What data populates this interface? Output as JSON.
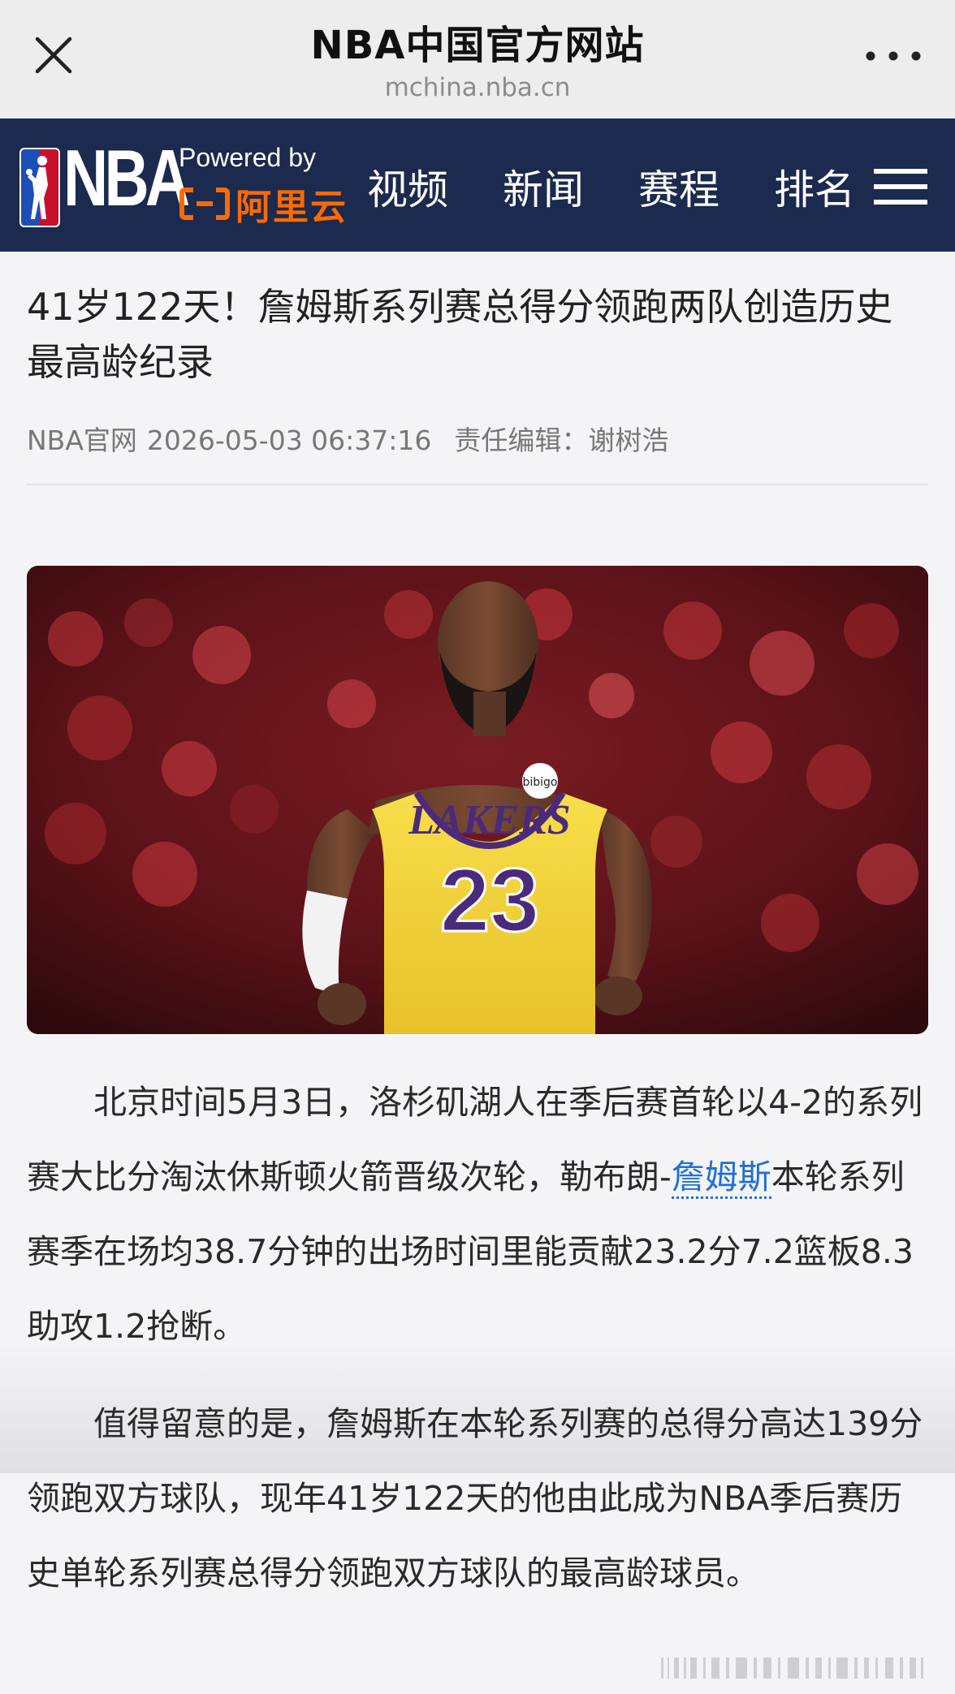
{
  "topbar": {
    "title": "NBA中国官方网站",
    "url": "mchina.nba.cn"
  },
  "navbar": {
    "logo": "NBA",
    "powered_by": "Powered by",
    "sponsor": "阿里云",
    "tabs": [
      "视频",
      "新闻",
      "赛程",
      "排名"
    ]
  },
  "article": {
    "title": "41岁122天！詹姆斯系列赛总得分领跑两队创造历史最高龄纪录",
    "source": "NBA官网",
    "datetime": "2026-05-03 06:37:16",
    "editor": "责任编辑：谢树浩",
    "image": {
      "jersey_team": "LAKERS",
      "jersey_number": "23",
      "patch": "bibigo"
    },
    "paragraph1": {
      "before_link": "北京时间5月3日，洛杉矶湖人在季后赛首轮以4-2的系列赛大比分淘汰休斯顿火箭晋级次轮，勒布朗-",
      "link": "詹姆斯",
      "after_link": "本轮系列赛季在场均38.7分钟的出场时间里能贡献23.2分7.2篮板8.3助攻1.2抢断。"
    },
    "paragraph2": "值得留意的是，詹姆斯在本轮系列赛的总得分高达139分领跑双方球队，现年41岁122天的他由此成为NBA季后赛历史单轮系列赛总得分领跑双方球队的最高龄球员。"
  },
  "colors": {
    "nav_bg": "#1b2a4e",
    "sponsor": "#ff6a00",
    "link": "#1f6fd6",
    "jersey": "#f5d63d",
    "jersey_text": "#4b2a7b"
  }
}
